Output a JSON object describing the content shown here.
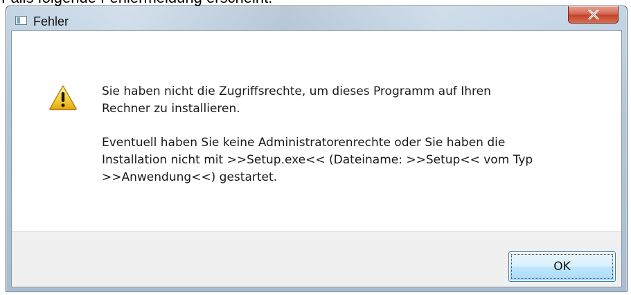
{
  "background_caption": {
    "text": "Falls folgende Fehlermeldung erscheint:"
  },
  "window": {
    "title": "Fehler",
    "icon": "app-window-icon",
    "close_icon": "close-x-icon",
    "accent_close_color": "#c3442c"
  },
  "dialog": {
    "icon": "warning-triangle-icon",
    "message_line_1": "Sie haben nicht die Zugriffsrechte, um dieses Programm auf Ihren\nRechner zu installieren.",
    "message_line_2": "Eventuell haben Sie keine Administratorenrechte oder Sie haben die\nInstallation nicht mit >>Setup.exe<< (Dateiname: >>Setup<< vom Typ\n>>Anwendung<<) gestartet."
  },
  "buttons": {
    "ok_label": "OK"
  }
}
